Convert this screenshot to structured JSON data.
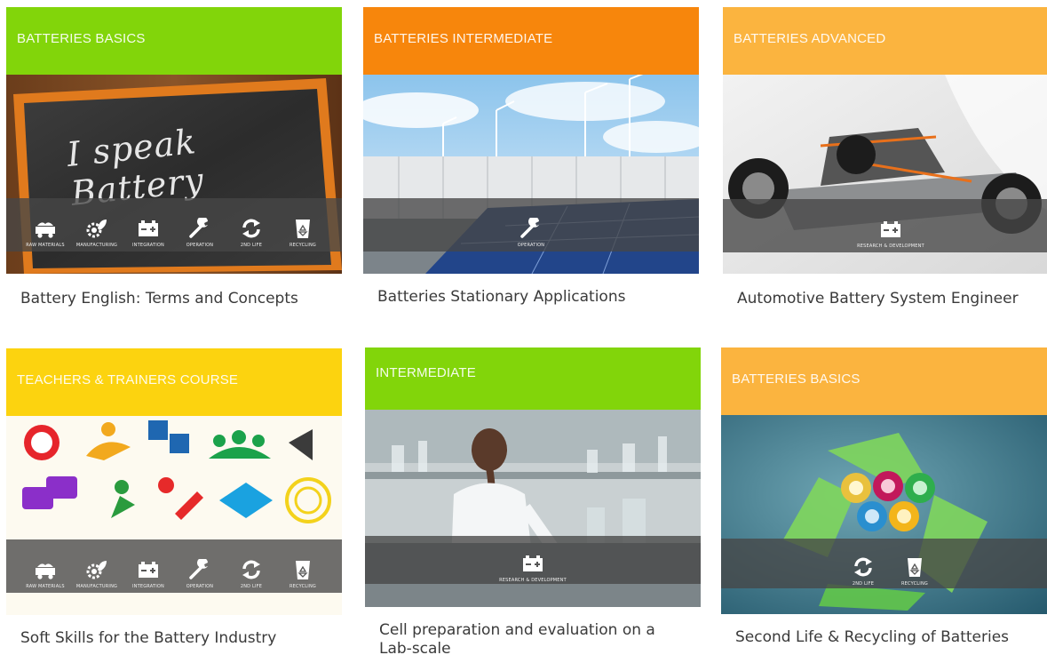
{
  "courses": [
    {
      "category": "BATTERIES BASICS",
      "title": "Battery English: Terms and Concepts",
      "header_color": "#82d50a",
      "image": "chalkboard-i-speak-battery",
      "chalkboard_text": "I speak Battery",
      "icons": [
        "mine-cart-icon",
        "gear-leaf-icon",
        "battery-icon",
        "wrench-icon",
        "recycle-arrows-icon",
        "recycle-bin-icon"
      ],
      "icon_labels": [
        "RAW MATERIALS",
        "MANUFACTURING",
        "INTEGRATION",
        "OPERATION",
        "2ND LIFE",
        "RECYCLING"
      ]
    },
    {
      "category": "BATTERIES INTERMEDIATE",
      "title": "Batteries Stationary Applications",
      "header_color": "#f7860c",
      "image": "solar-panels-wind-turbines",
      "icons": [
        "wrench-icon"
      ],
      "icon_labels": [
        "OPERATION"
      ]
    },
    {
      "category": "BATTERIES ADVANCED",
      "title": "Automotive Battery System Engineer",
      "header_color": "#fbb43f",
      "image": "ev-chassis-battery-pack",
      "icons": [
        "battery-icon"
      ],
      "icon_labels": [
        "RESEARCH & DEVELOPMENT"
      ]
    },
    {
      "category": "TEACHERS & TRAINERS COURSE",
      "title": "Soft Skills for the Battery Industry",
      "header_color": "#fcd30f",
      "image": "soft-skills-icons-collage",
      "icons": [
        "mine-cart-icon",
        "gear-leaf-icon",
        "battery-icon",
        "wrench-icon",
        "recycle-arrows-icon",
        "recycle-bin-icon"
      ],
      "icon_labels": [
        "RAW MATERIALS",
        "MANUFACTURING",
        "INTEGRATION",
        "OPERATION",
        "2ND LIFE",
        "RECYCLING"
      ]
    },
    {
      "category": "INTERMEDIATE",
      "title": "Cell preparation and evaluation on a Lab-scale",
      "header_color": "#82d50a",
      "image": "scientist-in-laboratory",
      "icons": [
        "battery-icon"
      ],
      "icon_labels": [
        "RESEARCH & DEVELOPMENT"
      ]
    },
    {
      "category": "BATTERIES BASICS",
      "title": "Second Life & Recycling of Batteries",
      "header_color": "#fbb43f",
      "image": "recycle-symbol-with-batteries",
      "icons": [
        "recycle-arrows-icon",
        "recycle-bin-icon"
      ],
      "icon_labels": [
        "2ND LIFE",
        "RECYCLING"
      ]
    }
  ]
}
